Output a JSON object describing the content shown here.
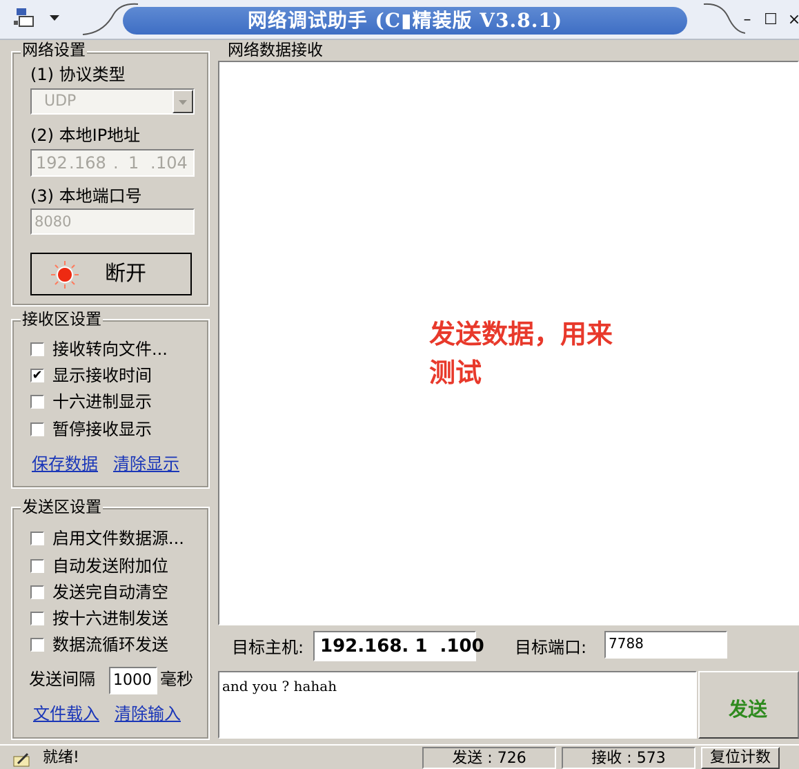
{
  "window": {
    "title": "网络调试助手 (C▮精装版 V3.8.1)",
    "min_symbol": "–",
    "max_symbol": "☐",
    "close_symbol": "×"
  },
  "network_settings": {
    "group_title": "网络设置",
    "protocol_label": "(1) 协议类型",
    "protocol_value": "UDP",
    "local_ip_label": "(2) 本地IP地址",
    "local_ip": [
      "192",
      "168",
      "1",
      "104"
    ],
    "local_port_label": "(3) 本地端口号",
    "local_port": "8080",
    "connect_button": "断开"
  },
  "receive_settings": {
    "group_title": "接收区设置",
    "options": [
      {
        "label": "接收转向文件...",
        "checked": false
      },
      {
        "label": "显示接收时间",
        "checked": true
      },
      {
        "label": "十六进制显示",
        "checked": false
      },
      {
        "label": "暂停接收显示",
        "checked": false
      }
    ],
    "save_link": "保存数据",
    "clear_link": "清除显示"
  },
  "send_settings": {
    "group_title": "发送区设置",
    "options": [
      {
        "label": "启用文件数据源...",
        "checked": false
      },
      {
        "label": "自动发送附加位",
        "checked": false
      },
      {
        "label": "发送完自动清空",
        "checked": false
      },
      {
        "label": "按十六进制发送",
        "checked": false
      },
      {
        "label": "数据流循环发送",
        "checked": false
      }
    ],
    "interval_label": "发送间隔",
    "interval_value": "1000",
    "interval_unit": "毫秒",
    "load_file_link": "文件载入",
    "clear_input_link": "清除输入"
  },
  "receive_area": {
    "group_title": "网络数据接收",
    "overlay_line1": "发送数据，用来",
    "overlay_line2": "测试",
    "overlay_color": "#e8392b"
  },
  "target": {
    "host_label": "目标主机:",
    "host_value": "192.168. 1  .100",
    "port_label": "目标端口:",
    "port_value": "7788"
  },
  "send_area": {
    "input_value": "and you ? hahah",
    "send_button": "发送",
    "send_button_color": "#2e8a1e"
  },
  "status_bar": {
    "status_text": "就绪!",
    "sent_label": "发送 : 726",
    "received_label": "接收 : 573",
    "reset_button": "复位计数"
  }
}
